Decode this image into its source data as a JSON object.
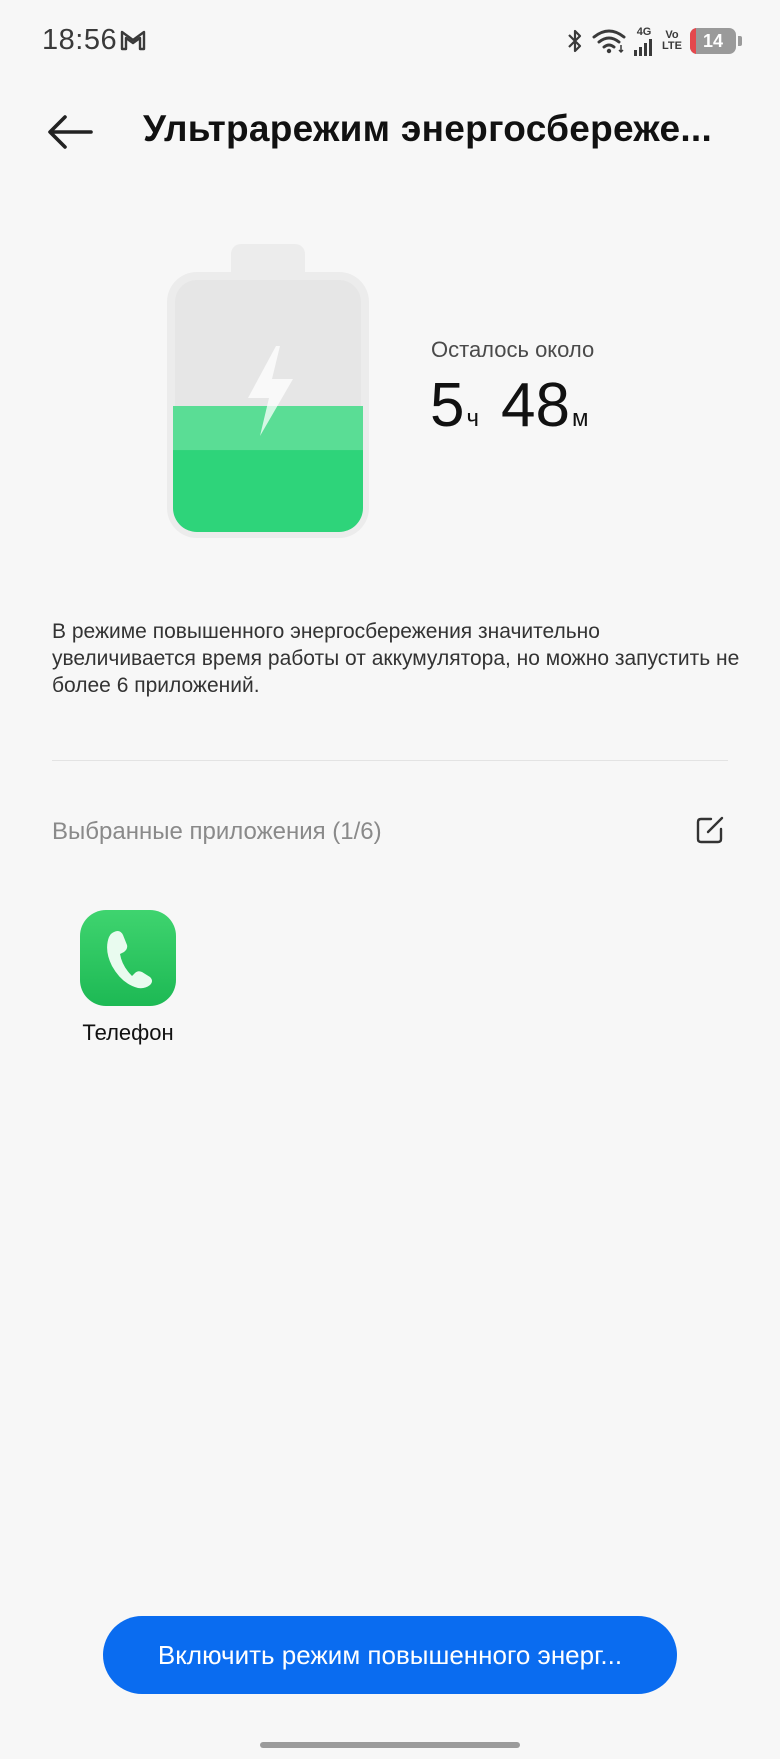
{
  "status_bar": {
    "time": "18:56",
    "network_type": "4G",
    "volte_top": "Vo",
    "volte_bottom": "LTE",
    "battery_level": "14",
    "battery_fraction": 0.14
  },
  "header": {
    "title": "Ультрарежим энергосбереже..."
  },
  "battery": {
    "remaining_label": "Осталось около",
    "hours": "5",
    "hours_unit": "ч",
    "minutes": "48",
    "minutes_unit": "м",
    "fill_fraction": 0.5,
    "fill_color": "#2ed47a"
  },
  "description": "В режиме повышенного энергосбережения значительно увеличивается время работы от аккумулятора, но можно запустить не более 6 приложений.",
  "apps_section": {
    "title": "Выбранные приложения (1/6)",
    "apps": [
      {
        "label": "Телефон",
        "icon": "phone-icon"
      }
    ]
  },
  "action_button": {
    "label": "Включить режим повышенного энерг..."
  },
  "colors": {
    "accent": "#0a6cf0",
    "background": "#f7f7f7"
  }
}
